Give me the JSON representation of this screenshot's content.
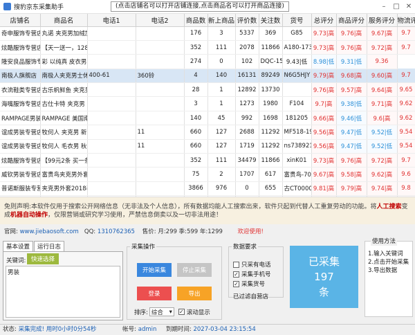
{
  "window": {
    "title": "搜豹京东采集助手",
    "notice": "(点击店铺名可以打开店铺连接,点击商品名可以打开商品连接)"
  },
  "grid": {
    "headers": [
      "店铺名",
      "商品名",
      "电话1",
      "电话2",
      "商品数",
      "新上商品",
      "评价数",
      "关注数",
      "货号",
      "总评分",
      "商品评分",
      "服务评分",
      "物流评"
    ],
    "rows": [
      [
        "奇申服饰专营店",
        "丸诺 夹克男加绒加",
        "",
        "",
        "176",
        "3",
        "5337",
        "369",
        "G85",
        "9.73|高",
        "9.76|高",
        "9.67|高",
        "9.7"
      ],
      [
        "炫酷服饰专营店",
        "【天一送一，128",
        "",
        "",
        "352",
        "111",
        "2078",
        "11866",
        "A180-173",
        "9.73|高",
        "9.76|高",
        "9.72|高",
        "9.7"
      ],
      [
        "隆安良品服饰专营店",
        "彩 以纯真 皮衣男",
        "",
        "",
        "274",
        "0",
        "102",
        "DQC-1566",
        "9.43|低",
        "8.98|低",
        "9.31|低",
        "9.36"
      ],
      [
        "南极人旗舰店",
        "南极人夹克男士休",
        "400-61",
        "360铃",
        "4",
        "140",
        "16131",
        "89249",
        "N6G5HJY",
        "9.79|高",
        "9.68|高",
        "9.60|高",
        "9.7"
      ],
      [
        "衣流鞋类专营店",
        "古乐帆鲜鱼 夹克男",
        "",
        "",
        "28",
        "1",
        "12892",
        "13730",
        "",
        "9.76|高",
        "9.57|高",
        "9.64|高",
        "9.65"
      ],
      [
        "海嘴服饰专营店",
        "古仕卡特 夹克男",
        "",
        "",
        "3",
        "1",
        "1273",
        "1980",
        "F104",
        "9.7|高",
        "9.38|低",
        "9.71|高",
        "9.62"
      ],
      [
        "RAMPAGE男装旗",
        "RAMPAGE 美国南",
        "",
        "",
        "140",
        "45",
        "992",
        "1698",
        "181205",
        "9.66|高",
        "9.46|低",
        "9.6|高",
        "9.62"
      ],
      [
        "谊成男装专营店",
        "牧何人 夹克男 新",
        "",
        "11",
        "660",
        "127",
        "2688",
        "11292",
        "MF518-19",
        "9.56|高",
        "9.47|低",
        "9.52|低",
        "9.54"
      ],
      [
        "谊成男装专营店",
        "牧何人 毛衣男 秋",
        "",
        "11",
        "660",
        "127",
        "1719",
        "11292",
        "ns738921",
        "9.56|高",
        "9.47|低",
        "9.52|低",
        "9.54"
      ],
      [
        "炫酷服饰专营店",
        "【99元2条 买一条",
        "",
        "",
        "352",
        "111",
        "34479",
        "11866",
        "xinK01",
        "9.73|高",
        "9.76|高",
        "9.72|高",
        "9.7"
      ],
      [
        "威钦男装专营店",
        "富贵鸟夹克男外套",
        "",
        "",
        "75",
        "2",
        "1707",
        "617",
        "富贵鸟-70",
        "9.67|高",
        "9.58|高",
        "9.62|高",
        "9.6"
      ],
      [
        "普诺斯服装专营店",
        "夹克男外套2018春",
        "",
        "",
        "3866",
        "976",
        "0",
        "655",
        "古CT0000",
        "9.81|高",
        "9.79|高",
        "9.74|高",
        "9.8"
      ],
      [
        "欧驰服饰专营店",
        "木宸 夹克男2018秋",
        "",
        "",
        "8",
        "3",
        "3687",
        "2001",
        "K686",
        "9.69|高",
        "9.25|低",
        "9.76|高",
        "9.71"
      ],
      [
        "布彩服饰专营店",
        "伟奇保罗 夹克男2",
        "",
        "15",
        "660",
        "21",
        "4653",
        "3886",
        "03",
        "9.76|高",
        "9.75|高",
        "9.74|高",
        "9.6"
      ],
      [
        "北极绒四夕专营店",
        "北极绒夹克男外套",
        "",
        "",
        "58",
        "19",
        "7653",
        "15121",
        "B9802",
        "9.83|高",
        "9.83|高",
        "9.74|高",
        "9.8"
      ]
    ]
  },
  "statusline": {
    "disclaimer": "免则声明:本软件仅用于搜索公开网络信息（无非法及个人信息），所有数据均能人工搜索出来，软件只起到代替人工重复劳动的功能。将",
    "highlight1": "人工搜索",
    "mid": "变成",
    "highlight2": "机器自动操作",
    "tail": "，仅限营销或研究学习使用，严禁信息倒卖以及一切非法用途！"
  },
  "infobar": {
    "site_label": "官网:",
    "site": "www.jiebaosoft.com",
    "qq_label": "QQ:",
    "qq": "1310762365",
    "prices": "售价: 月:299 季:599 年:1299",
    "hello": "欢迎使用!"
  },
  "tabs": [
    "基本设置",
    "运行日志"
  ],
  "keywords": {
    "label": "关键词:",
    "button": "快速选择",
    "text": "男装"
  },
  "collect": {
    "legend": "采集操作",
    "start": "开始采集",
    "stop": "停止采集",
    "login": "登录",
    "export": "导出",
    "sort_label": "排序:",
    "sort_value": "综合",
    "scroll": "滚动显示"
  },
  "data_req": {
    "legend": "数据要求",
    "phone_only": "只采有电话",
    "collect_phone": "采集手机号",
    "collect_sku": "采集货号",
    "status": "已过滤自营店"
  },
  "result": {
    "line1": "已采集",
    "count": "197",
    "unit": "条"
  },
  "usage": {
    "legend": "使用方法",
    "steps": [
      "1.输入关键词",
      "2.点击开始采集",
      "3.导出数据"
    ]
  },
  "bottom": {
    "status_label": "状态:",
    "status": "采集完成! 用时0小时0分54秒",
    "account_label": "帐号:",
    "account": "admin",
    "expire_label": "到期时间:",
    "expire": "2027-03-04 23:15:54"
  },
  "colors": {
    "red": "#e03030",
    "blue": "#2a8fd8",
    "start": "#3a87de",
    "login": "#ec4f4f",
    "export": "#f7a326",
    "result": "#5ab4e6"
  }
}
